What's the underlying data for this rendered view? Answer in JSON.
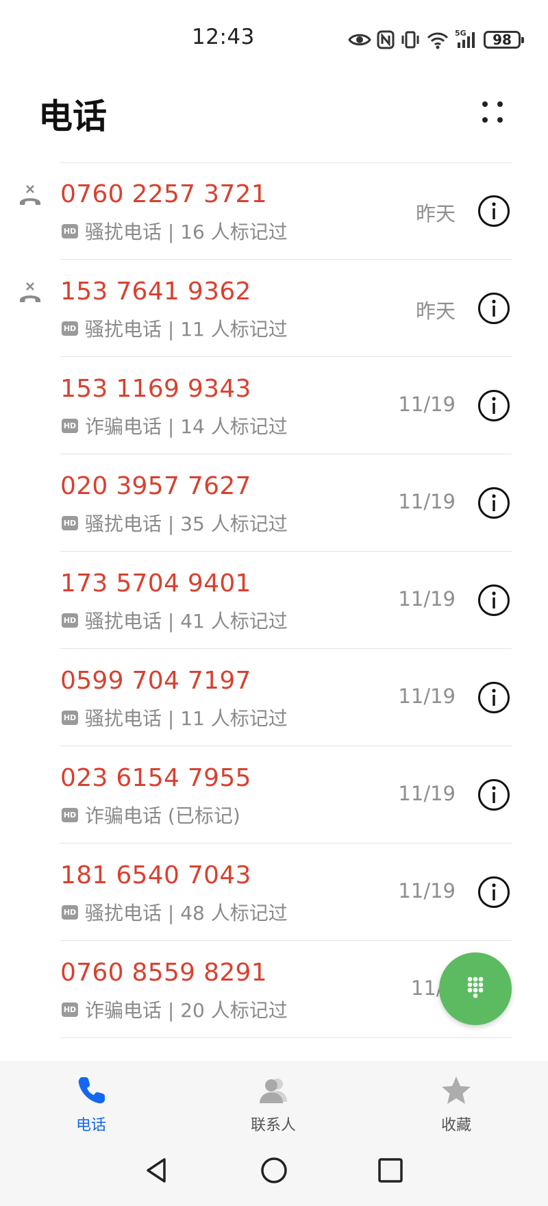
{
  "status_bar": {
    "time": "12:43",
    "battery": "98",
    "signal_label": "5G",
    "icons": [
      "eye-icon",
      "nfc-icon",
      "vibrate-icon",
      "wifi-icon",
      "signal-icon",
      "battery-icon"
    ]
  },
  "header": {
    "title": "电话",
    "more_icon": "more-dots-icon"
  },
  "calls": [
    {
      "number": "0760 2257 3721",
      "desc": "骚扰电话 | 16 人标记过",
      "date": "昨天",
      "missed": true
    },
    {
      "number": "153 7641 9362",
      "desc": "骚扰电话 | 11 人标记过",
      "date": "昨天",
      "missed": true
    },
    {
      "number": "153 1169 9343",
      "desc": "诈骗电话 | 14 人标记过",
      "date": "11/19",
      "missed": false
    },
    {
      "number": "020 3957 7627",
      "desc": "骚扰电话 | 35 人标记过",
      "date": "11/19",
      "missed": false
    },
    {
      "number": "173 5704 9401",
      "desc": "骚扰电话 | 41 人标记过",
      "date": "11/19",
      "missed": false
    },
    {
      "number": "0599 704 7197",
      "desc": "骚扰电话 | 11 人标记过",
      "date": "11/19",
      "missed": false
    },
    {
      "number": "023 6154 7955",
      "desc": "诈骗电话 (已标记)",
      "date": "11/19",
      "missed": false
    },
    {
      "number": "181 6540 7043",
      "desc": "骚扰电话 | 48 人标记过",
      "date": "11/19",
      "missed": false
    },
    {
      "number": "0760 8559 8291",
      "desc": "诈骗电话 | 20 人标记过",
      "date": "11/1",
      "missed": false
    }
  ],
  "hd_badge": "HD",
  "bottom_nav": {
    "phone": "电话",
    "contacts": "联系人",
    "favorites": "收藏",
    "active": "phone"
  },
  "colors": {
    "number": "#d8412f",
    "fab": "#5cbb61",
    "active_tab": "#1467f0"
  }
}
